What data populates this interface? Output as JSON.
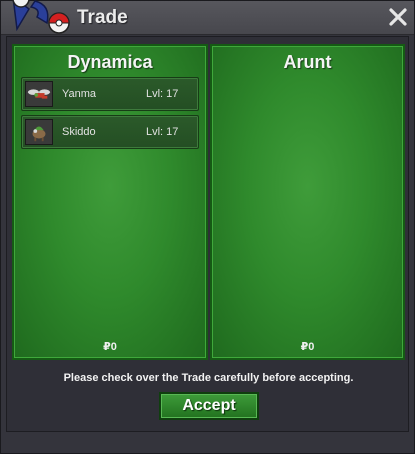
{
  "window": {
    "title": "Trade",
    "close_glyph": "✕"
  },
  "left_panel": {
    "player_name": "Dynamica",
    "pokemon": [
      {
        "name": "Yanma",
        "level": "Lvl: 17",
        "icon": "yanma-sprite-icon"
      },
      {
        "name": "Skiddo",
        "level": "Lvl: 17",
        "icon": "skiddo-sprite-icon"
      }
    ],
    "money": "₽0"
  },
  "right_panel": {
    "player_name": "Arunt",
    "pokemon": [],
    "money": "₽0"
  },
  "footer": {
    "notice": "Please check over the Trade carefully before accepting.",
    "accept_label": "Accept"
  },
  "colors": {
    "panel_green": "#2f8a2c",
    "button_green": "#2e8a2b",
    "window_bg": "#34343c"
  }
}
